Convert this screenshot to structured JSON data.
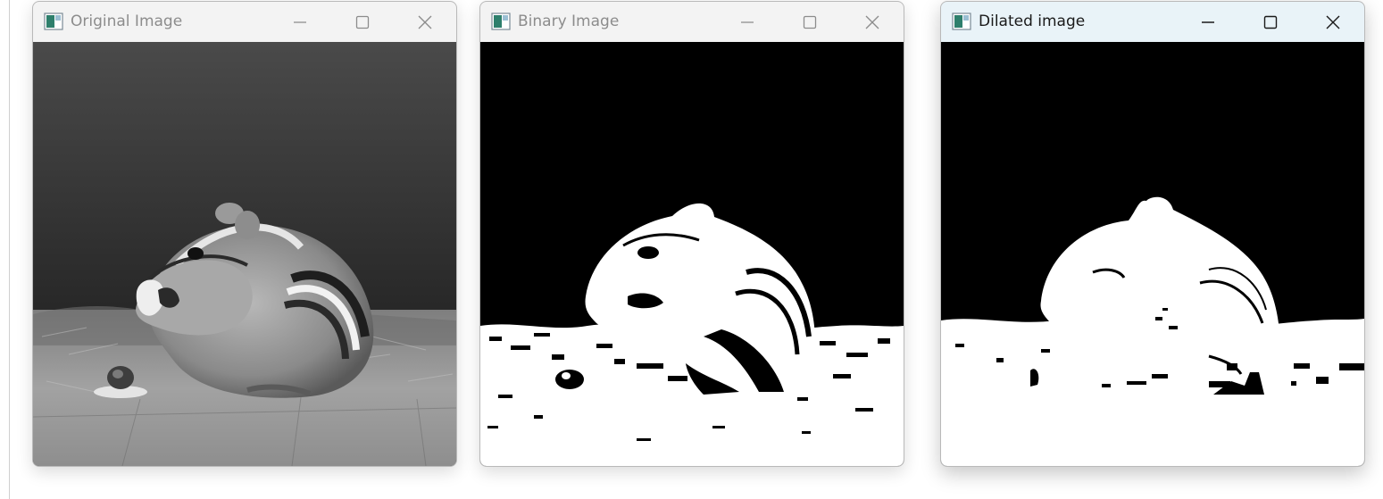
{
  "windows": [
    {
      "title": "Original Image",
      "state": "inactive",
      "controls": [
        "minimize-icon",
        "maximize-icon",
        "close-icon"
      ],
      "content": "grayscale photo of a chipmunk eating beside a small snail shell"
    },
    {
      "title": "Binary Image",
      "state": "inactive",
      "controls": [
        "minimize-icon",
        "maximize-icon",
        "close-icon"
      ],
      "content": "thresholded black and white version of the chipmunk photo"
    },
    {
      "title": "Dilated image",
      "state": "active",
      "controls": [
        "minimize-icon",
        "maximize-icon",
        "close-icon"
      ],
      "content": "dilated binary version showing enlarged white regions"
    }
  ],
  "colors": {
    "active_titlebar": "#e9f3f8",
    "inactive_titlebar": "#f3f3f3",
    "active_title_text": "#1a1a1a",
    "inactive_title_text": "#8c8c8c",
    "binary_foreground": "#ffffff",
    "binary_background": "#000000"
  }
}
